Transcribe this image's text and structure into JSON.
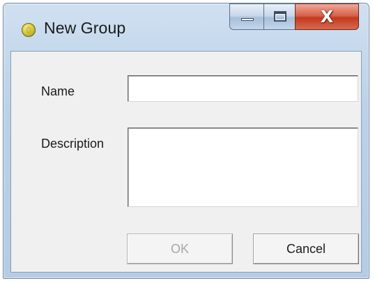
{
  "window": {
    "title": "New Group",
    "icon": "app-orb-icon",
    "controls": {
      "minimize_icon": "minimize-icon",
      "maximize_icon": "maximize-icon",
      "close_glyph": "X"
    },
    "colors": {
      "frame": "#bad1e8",
      "close_button": "#c23a1f"
    }
  },
  "form": {
    "name_label": "Name",
    "name_value": "",
    "description_label": "Description",
    "description_value": ""
  },
  "buttons": {
    "ok_label": "OK",
    "ok_enabled": false,
    "cancel_label": "Cancel"
  }
}
